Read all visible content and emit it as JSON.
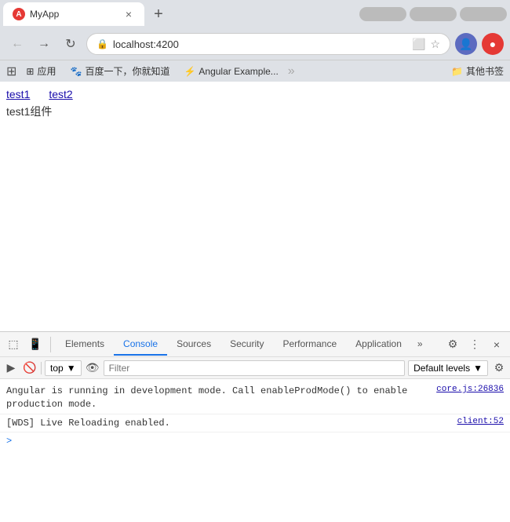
{
  "browser": {
    "tab": {
      "favicon_letter": "A",
      "title": "MyApp",
      "close_icon": "×"
    },
    "new_tab_icon": "+",
    "address": {
      "back_icon": "←",
      "forward_icon": "→",
      "reload_icon": "↻",
      "lock_icon": "🔒",
      "url": "localhost:4200",
      "translate_icon": "⬜",
      "bookmark_icon": "☆",
      "avatar_letter": "👤",
      "menu_icon": "●"
    },
    "bookmarks": {
      "grid_icon": "⊞",
      "items": [
        {
          "label": "应用",
          "icon": "⊞"
        },
        {
          "label": "百度一下，你就知道",
          "icon": "🐾"
        },
        {
          "label": "Angular Example...",
          "icon": "⚡"
        }
      ],
      "more_icon": "»",
      "other_label": "其他书签",
      "folder_icon": "📁"
    }
  },
  "page": {
    "link1": "test1",
    "link2": "test2",
    "component_text": "test1组件"
  },
  "devtools": {
    "toolbar": {
      "inspect_icon": "⬜",
      "device_icon": "□",
      "tabs": [
        "Elements",
        "Console",
        "Sources",
        "Security",
        "Performance",
        "Application"
      ],
      "active_tab": "Console",
      "more_icon": "»",
      "settings_icon": "⚙",
      "menu_icon": "⋮",
      "close_icon": "×"
    },
    "filter_bar": {
      "play_icon": "▶",
      "ban_icon": "🚫",
      "context_label": "top",
      "dropdown_icon": "▼",
      "eye_icon": "👁",
      "filter_placeholder": "Filter",
      "levels_label": "Default levels",
      "levels_dropdown": "▼",
      "settings_icon": "⚙"
    },
    "console": {
      "messages": [
        {
          "text": "Angular is running in development mode. Call enableProdMode() to enable production mode.",
          "source": "core.js:26836"
        },
        {
          "text": "[WDS] Live Reloading enabled.",
          "source": "client:52"
        }
      ],
      "prompt_icon": ">"
    }
  }
}
